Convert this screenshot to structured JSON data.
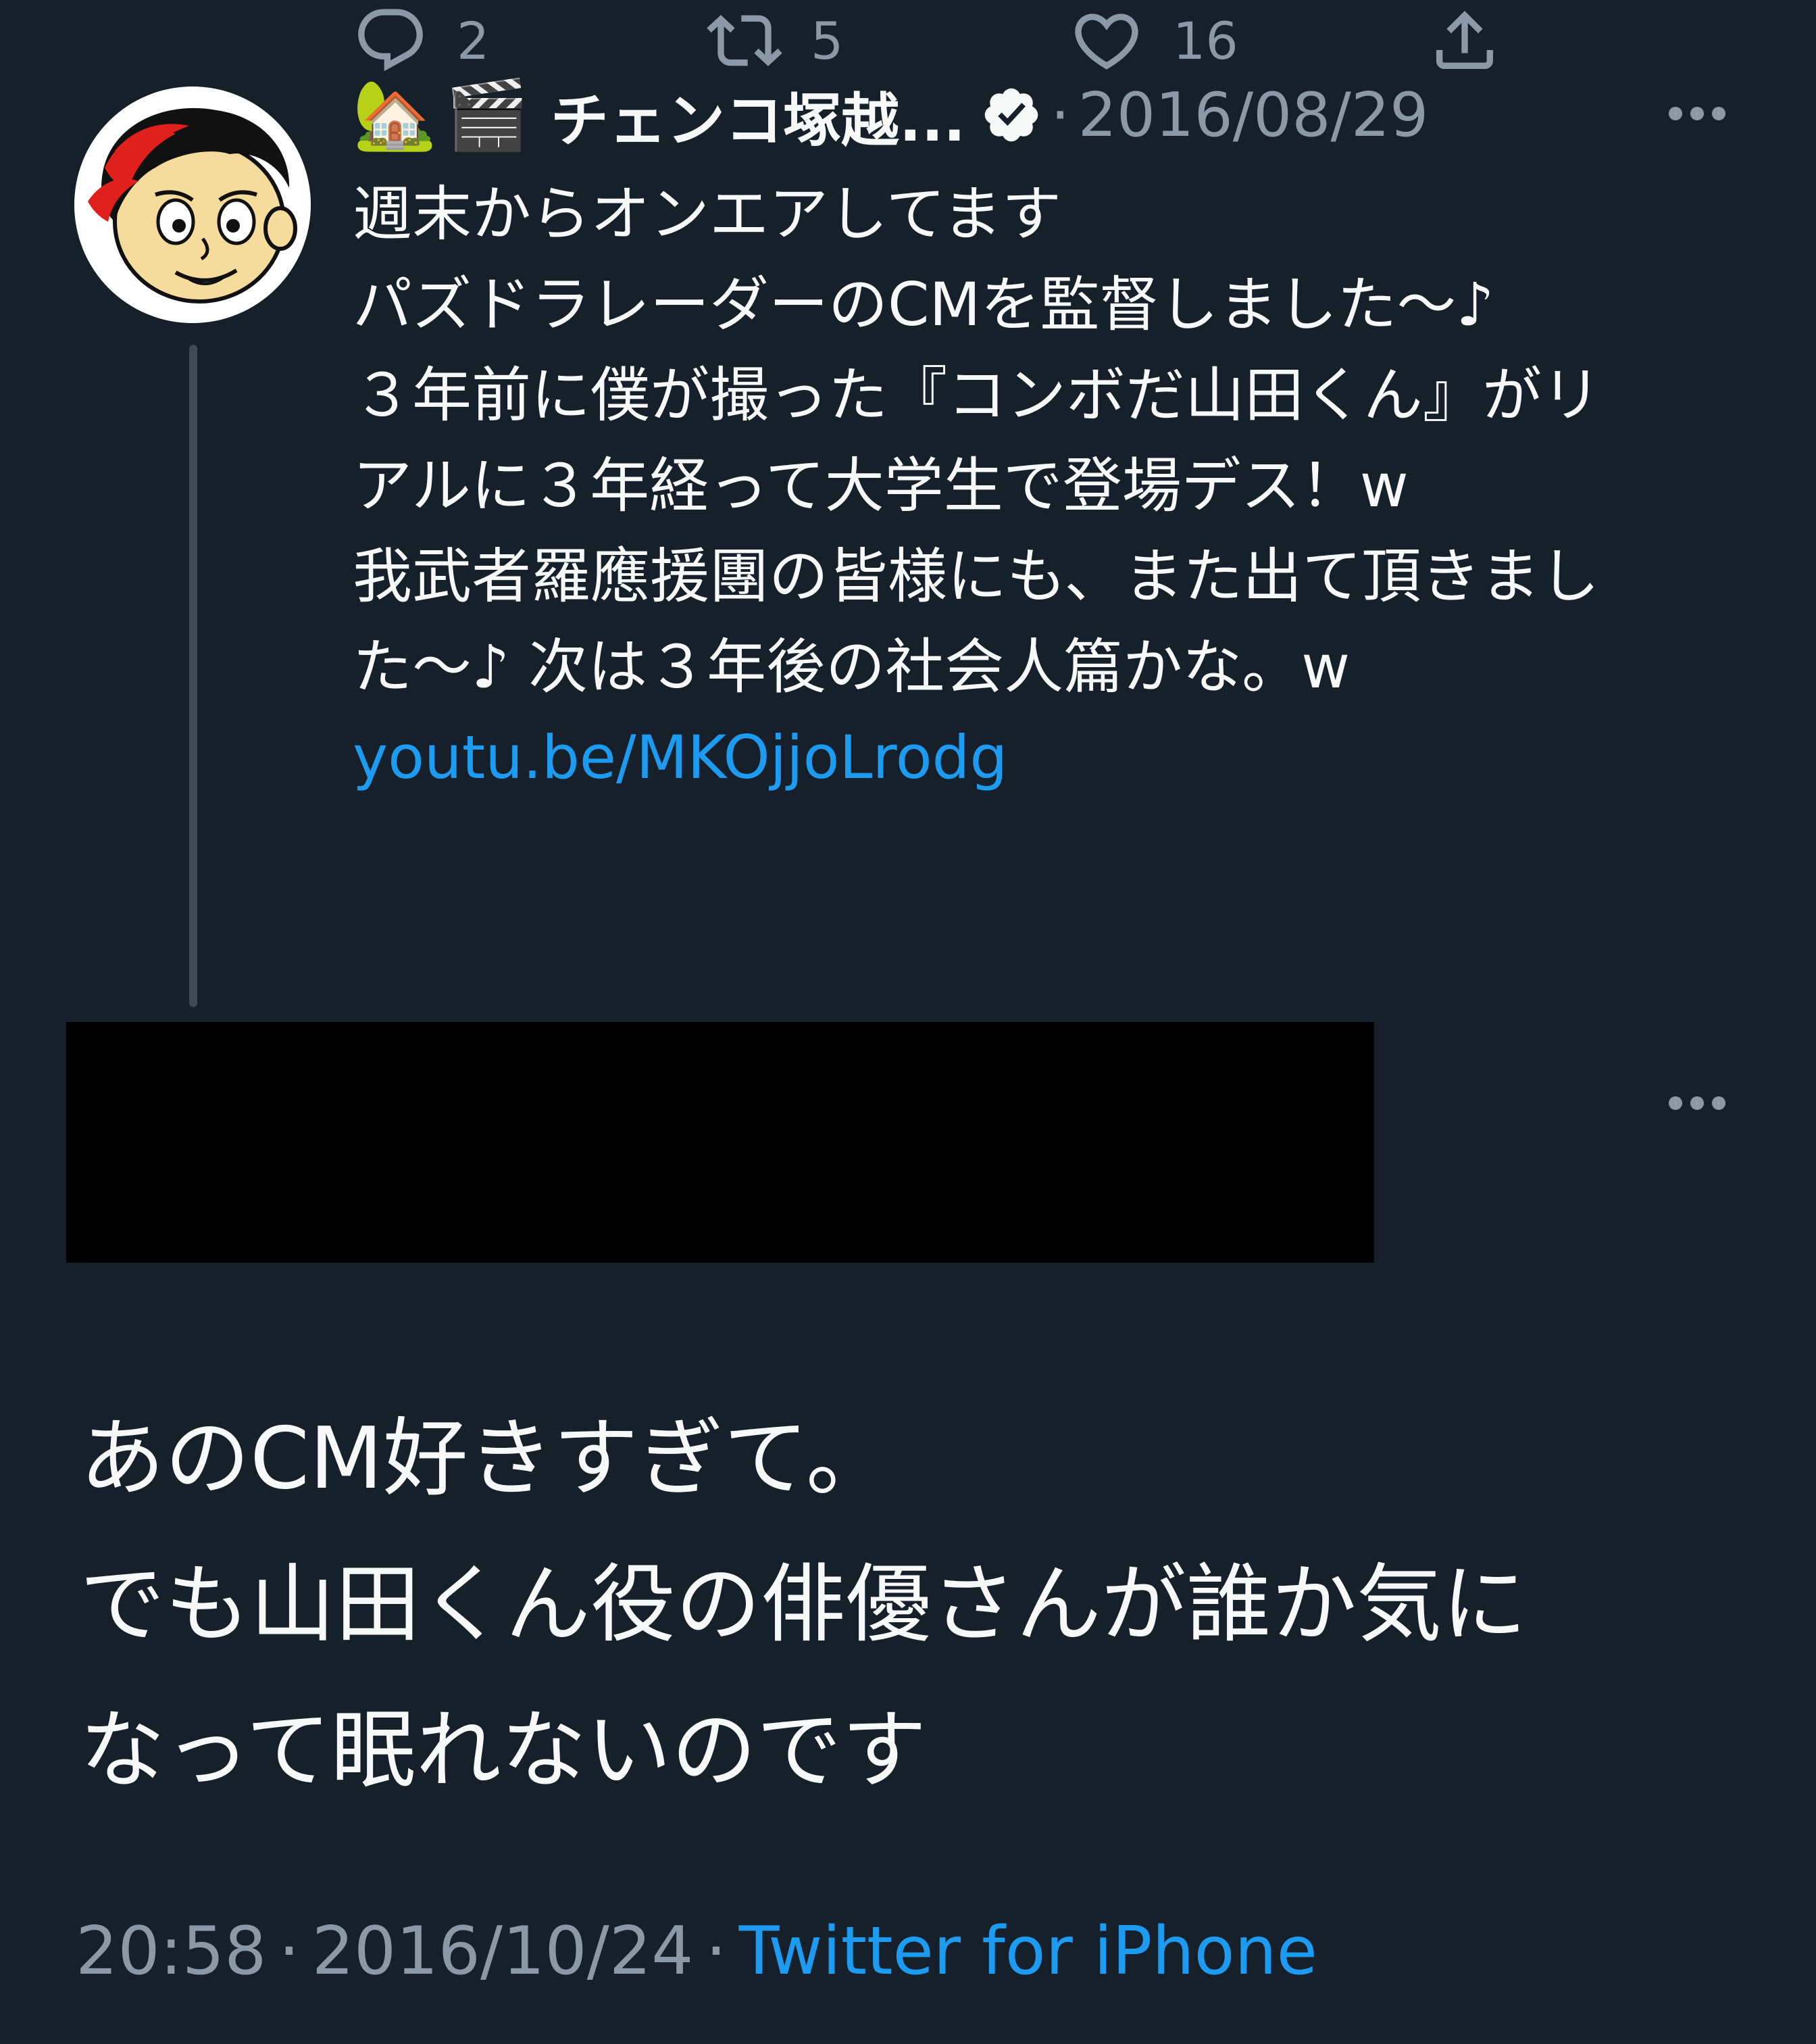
{
  "colors": {
    "background": "#15202b",
    "text_primary": "#f7f9f9",
    "text_secondary": "#8b98a5",
    "link": "#1d9bf0",
    "redaction": "#000000"
  },
  "parent_tweet": {
    "avatar": "cartoon-face-avatar",
    "name_emojis": [
      "🏡",
      "🎬"
    ],
    "display_name": "チェンコ塚越...",
    "verified_icon": "verified-badge-icon",
    "separator": "·",
    "date": "2016/08/29",
    "more_icon": "more-horizontal-icon",
    "text_lines": [
      "週末からオンエアしてます",
      "パズドラレーダーのCMを監督しました〜♪",
      "３年前に僕が撮った『コンボだ山田くん』がリ",
      "アルに３年経って大学生で登場デス！w",
      "我武者羅應援團の皆様にも、また出て頂きまし",
      "た〜♪ 次は３年後の社会人篇かな。w"
    ],
    "link": "youtu.be/MKOjjoLrodg",
    "actions": {
      "reply": {
        "icon": "reply-icon",
        "count": "2"
      },
      "retweet": {
        "icon": "retweet-icon",
        "count": "5"
      },
      "like": {
        "icon": "heart-icon",
        "count": "16"
      },
      "share": {
        "icon": "share-icon"
      }
    }
  },
  "reply_tweet": {
    "more_icon": "more-horizontal-icon",
    "text_lines": [
      "あのCM好きすぎて。",
      "でも山田くん役の俳優さんが誰か気に",
      "なって眠れないのです"
    ],
    "time": "20:58",
    "separator": "·",
    "date": "2016/10/24",
    "source": "Twitter for iPhone"
  }
}
